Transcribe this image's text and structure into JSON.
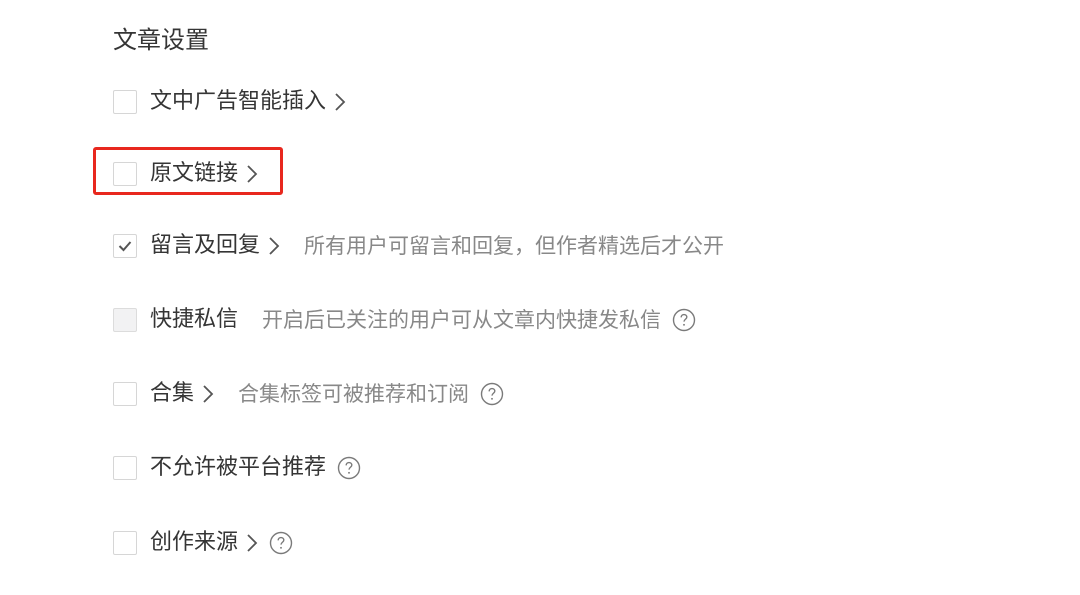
{
  "section": {
    "title": "文章设置"
  },
  "options": [
    {
      "label": "文中广告智能插入",
      "checked": false,
      "disabled": false,
      "has_arrow": true,
      "hint": "",
      "has_help": false
    },
    {
      "label": "原文链接",
      "checked": false,
      "disabled": false,
      "has_arrow": true,
      "hint": "",
      "has_help": false,
      "highlighted": true
    },
    {
      "label": "留言及回复",
      "checked": true,
      "disabled": false,
      "has_arrow": true,
      "hint": "所有用户可留言和回复，但作者精选后才公开",
      "has_help": false
    },
    {
      "label": "快捷私信",
      "checked": false,
      "disabled": true,
      "has_arrow": false,
      "hint": "开启后已关注的用户可从文章内快捷发私信",
      "has_help": true
    },
    {
      "label": "合集",
      "checked": false,
      "disabled": false,
      "has_arrow": true,
      "hint": "合集标签可被推荐和订阅",
      "has_help": true
    },
    {
      "label": "不允许被平台推荐",
      "checked": false,
      "disabled": false,
      "has_arrow": false,
      "hint": "",
      "has_help": true
    },
    {
      "label": "创作来源",
      "checked": false,
      "disabled": false,
      "has_arrow": true,
      "hint": "",
      "has_help": true
    }
  ],
  "colors": {
    "text": "#353535",
    "hint": "#888888",
    "checkbox_border": "#d6d6d6",
    "checkmark": "#555555",
    "icon": "#7a7a7a",
    "highlight": "#e8281e"
  }
}
